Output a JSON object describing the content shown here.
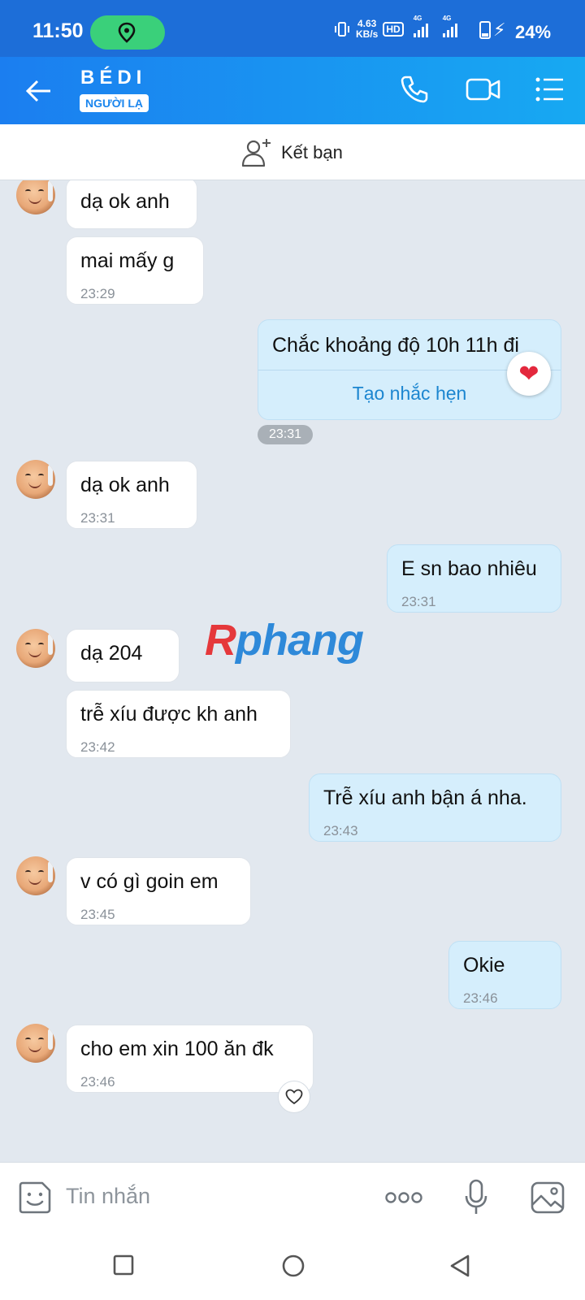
{
  "status_bar": {
    "time": "11:50",
    "speed_value": "4.63",
    "speed_unit": "KB/s",
    "hd": "HD",
    "net1": "4G",
    "net2": "4G",
    "battery": "24%"
  },
  "header": {
    "name": "BÉDI",
    "tag": "NGƯỜI LẠ",
    "icons": [
      "back-arrow-icon",
      "phone-icon",
      "video-call-icon",
      "menu-icon"
    ]
  },
  "friend_bar": {
    "label": "Kết bạn"
  },
  "messages": [
    {
      "side": "in",
      "text": "dạ ok anh",
      "time": ""
    },
    {
      "side": "in",
      "text": "mai mấy g",
      "time": "23:29"
    },
    {
      "side": "out",
      "text": "Chắc khoảng độ 10h 11h đi",
      "action": "Tạo nhắc hẹn",
      "time": "23:31",
      "reaction": "heart"
    },
    {
      "side": "in",
      "text": "dạ ok anh",
      "time": "23:31"
    },
    {
      "side": "out",
      "text": "E sn bao nhiêu",
      "time": "23:31"
    },
    {
      "side": "in",
      "text": "dạ 204",
      "time": ""
    },
    {
      "side": "in",
      "text": "trễ xíu được kh anh",
      "time": "23:42"
    },
    {
      "side": "out",
      "text": "Trễ xíu anh bận á nha.",
      "time": "23:43"
    },
    {
      "side": "in",
      "text": "v có gì goin em",
      "time": "23:45"
    },
    {
      "side": "out",
      "text": "Okie",
      "time": "23:46"
    },
    {
      "side": "in",
      "text": "cho em xin 100 ăn đk",
      "time": "23:46"
    }
  ],
  "watermark": {
    "part1": "R",
    "part2": "phang"
  },
  "input": {
    "placeholder": "Tin nhắn"
  },
  "colors": {
    "header_start": "#1b7ef0",
    "header_end": "#17a9f2",
    "out_bubble": "#d5eefc",
    "in_bubble": "#ffffff",
    "chat_bg": "#e2e8ef",
    "status_pill": "#3ad07a"
  }
}
